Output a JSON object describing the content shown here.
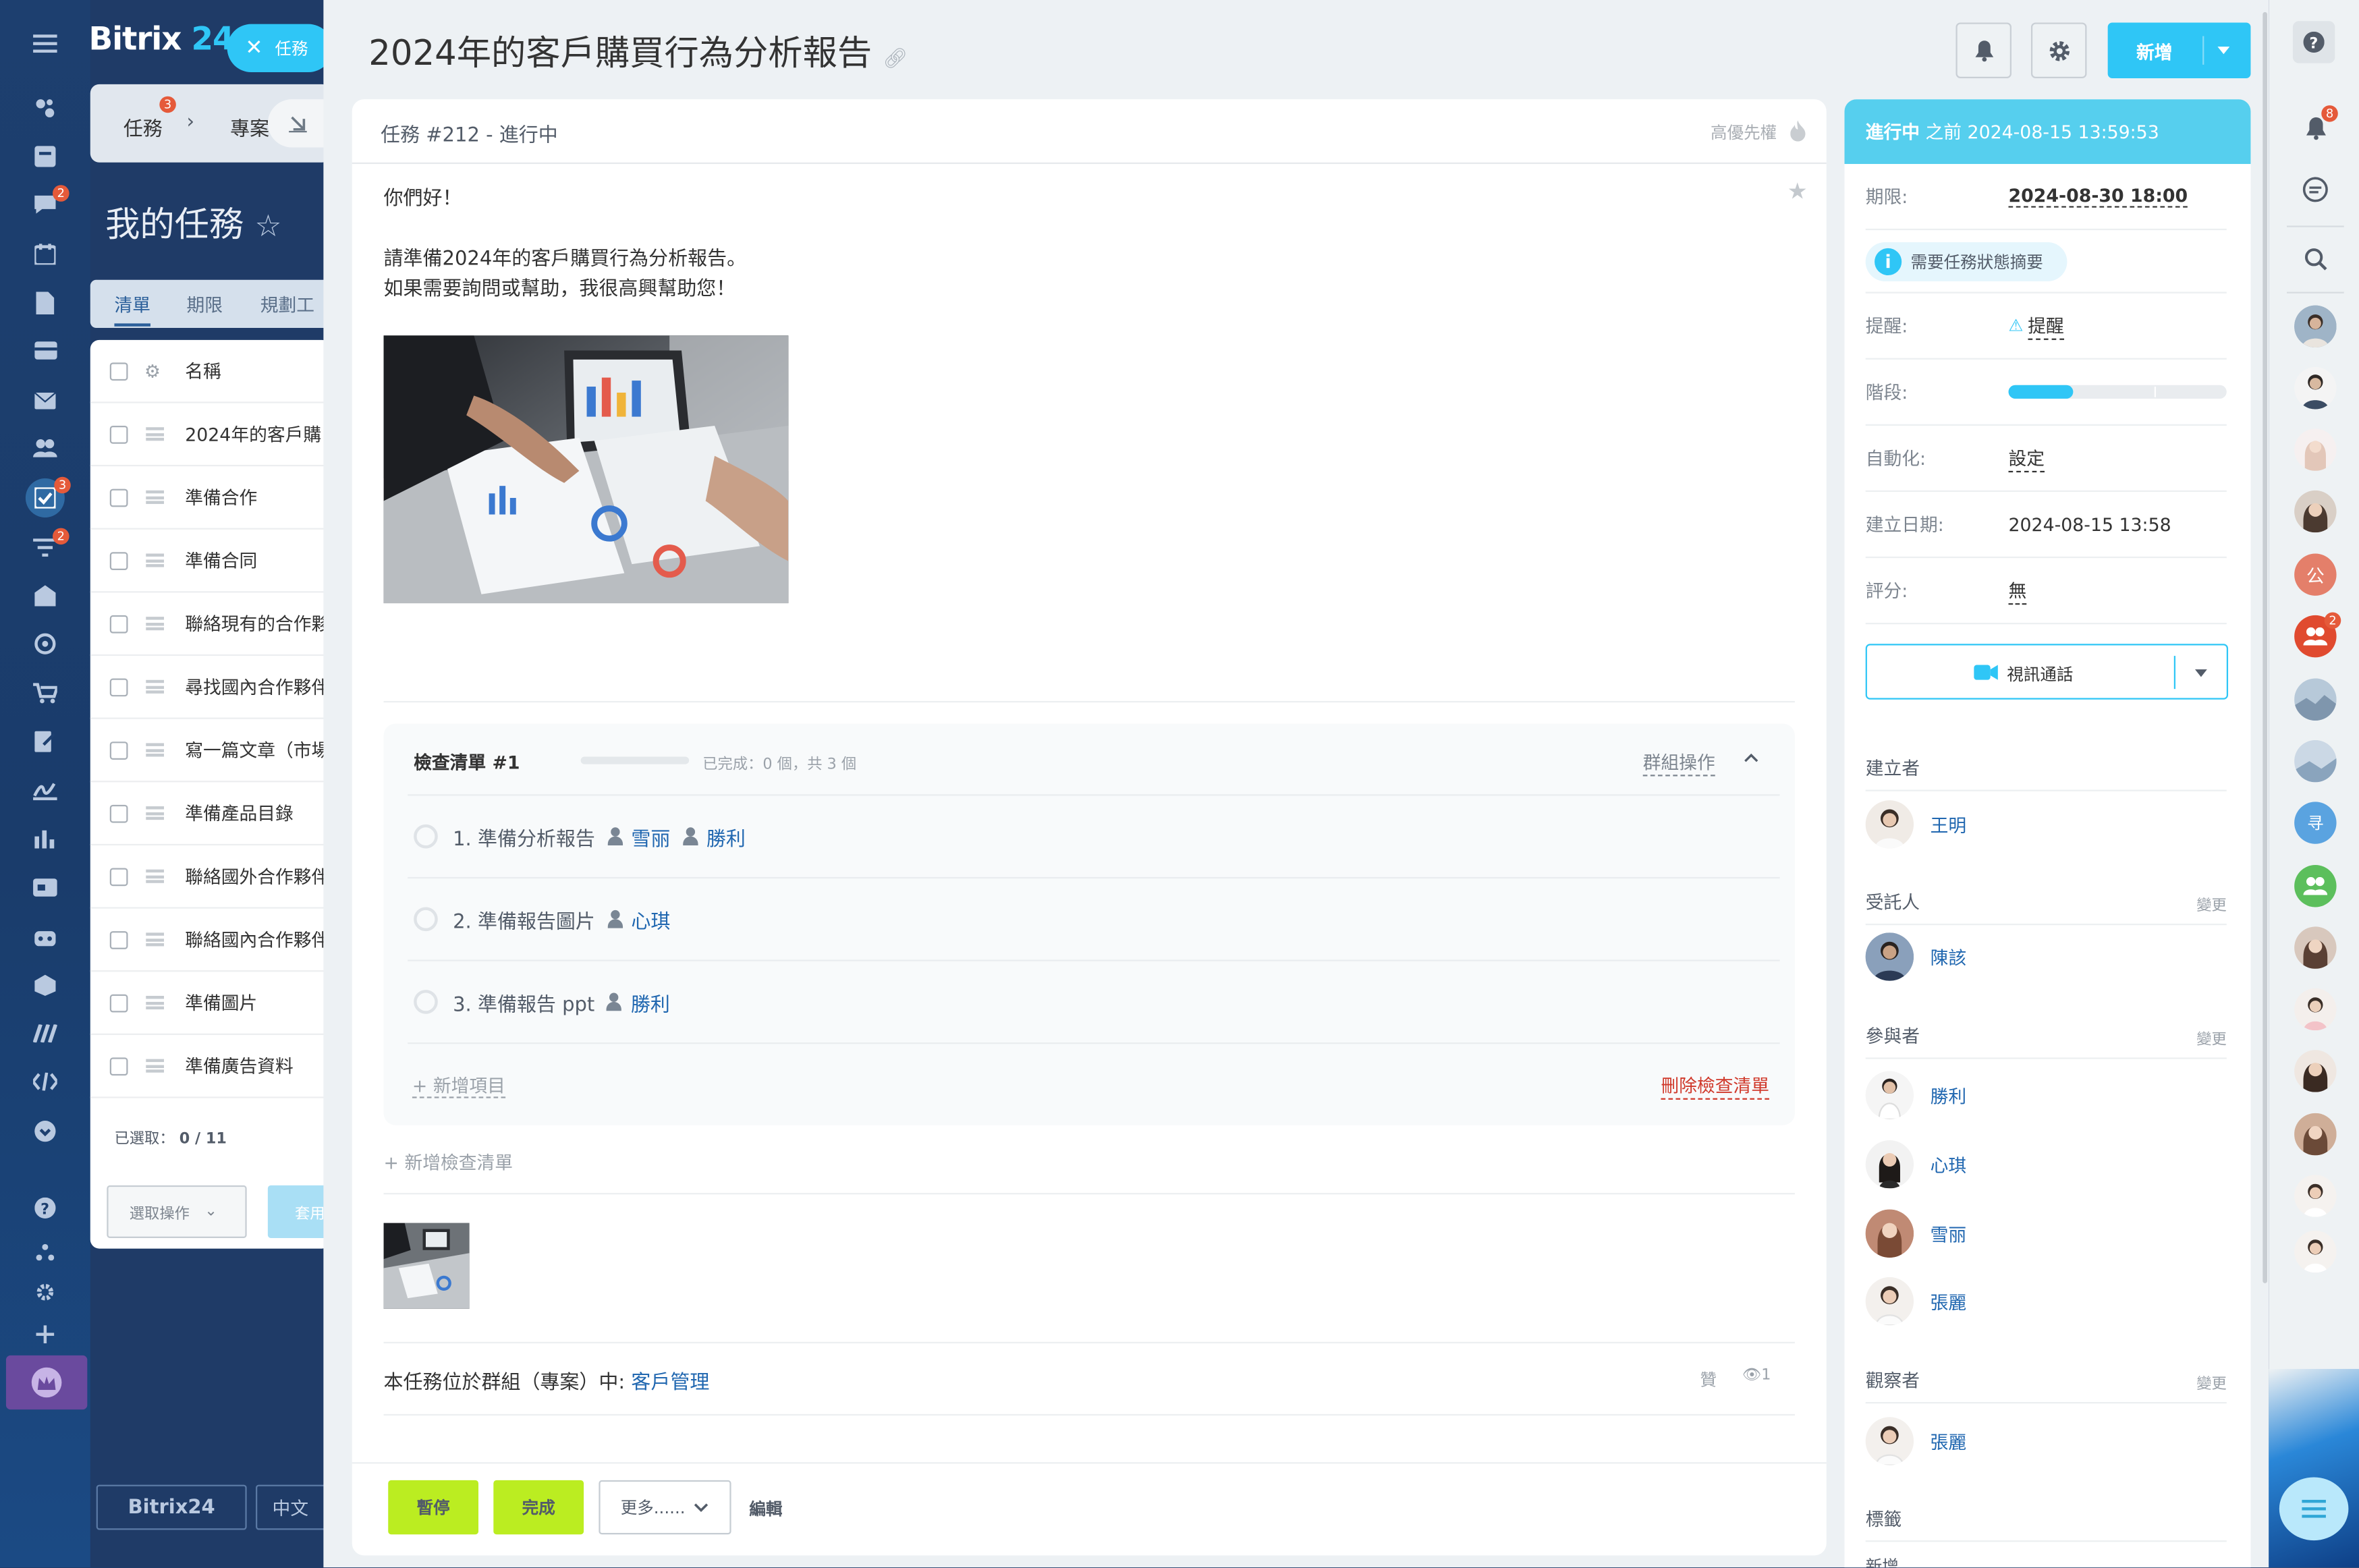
{
  "app": {
    "name_a": "Bitrix",
    "name_b": "24",
    "task_tab": "任務"
  },
  "breadcrumb": {
    "tasks": "任務",
    "tasks_badge": "3",
    "projects": "專案"
  },
  "list_page": {
    "title": "我的任務",
    "tabs": [
      "清單",
      "期限",
      "規劃工"
    ],
    "column_name": "名稱",
    "rows": [
      "2024年的客戶購",
      "準備合作",
      "準備合同",
      "聯絡現有的合作夥",
      "尋找國內合作夥伴",
      "寫一篇文章（市場",
      "準備產品目錄",
      "聯絡國外合作夥伴",
      "聯絡國內合作夥伴",
      "準備圖片",
      "準備廣告資料"
    ],
    "selected_label": "已選取：",
    "selected_value": "0 / 11",
    "select_action": "選取操作",
    "apply": "套用",
    "footer_brand": "Bitrix24",
    "footer_lang": "中文"
  },
  "nav_badges": {
    "chat": "2",
    "tasks": "3",
    "crm": "2"
  },
  "task": {
    "title": "2024年的客戶購買行為分析報告",
    "add_button": "新增",
    "header": "任務 #212 - 進行中",
    "priority": "高優先權",
    "body": [
      "你們好！",
      "",
      "請準備2024年的客戶購買行為分析報告。",
      "如果需要詢問或幫助，我很高興幫助您！"
    ],
    "checklist": {
      "title": "檢查清單 #1",
      "progress": "已完成：0 個，共 3 個",
      "progress_fraction": 0,
      "group_action": "群組操作",
      "items": [
        {
          "text": "1. 準備分析報告",
          "people": [
            "雪丽",
            "勝利"
          ]
        },
        {
          "text": "2. 準備報告圖片",
          "people": [
            "心琪"
          ]
        },
        {
          "text": "3. 準備報告 ppt",
          "people": [
            "勝利"
          ]
        }
      ],
      "add_item": "+ 新增項目",
      "delete": "刪除檢查清單"
    },
    "add_checklist": "+ 新增檢查清單",
    "group_prefix": "本任務位於群組（專案）中:",
    "group_name": "客戶管理",
    "like": "贊",
    "views": "1",
    "buttons": {
      "pause": "暫停",
      "complete": "完成",
      "more": "更多......",
      "edit": "編輯"
    }
  },
  "sidebar": {
    "status": "進行中",
    "status_since": "之前 2024-08-15 13:59:53",
    "deadline_label": "期限:",
    "deadline": "2024-08-30 18:00",
    "summary": "需要任務狀態摘要",
    "reminder_label": "提醒:",
    "reminder": "提醒",
    "stage_label": "階段:",
    "stage_fraction": 0.3,
    "automation_label": "自動化:",
    "automation": "設定",
    "created_label": "建立日期:",
    "created": "2024-08-15 13:58",
    "rating_label": "評分:",
    "rating": "無",
    "video_call": "視訊通話",
    "creator_label": "建立者",
    "creator": "王明",
    "assignee_label": "受託人",
    "assignee": "陳該",
    "participants_label": "參與者",
    "participants": [
      "勝利",
      "心琪",
      "雪丽",
      "張麗"
    ],
    "observers_label": "觀察者",
    "observers": [
      "張麗"
    ],
    "change": "變更",
    "tags_label": "標籤",
    "tags_add": "新增"
  },
  "right_strip": {
    "notif_badge": "8",
    "group_badge": "2",
    "letter_a": "公",
    "letter_b": "寻"
  },
  "colors": {
    "accent": "#2fc6f6",
    "green": "#bbed21",
    "nav_bg": "#1d3f6f",
    "link": "#2067b0",
    "red": "#e55a3a"
  }
}
